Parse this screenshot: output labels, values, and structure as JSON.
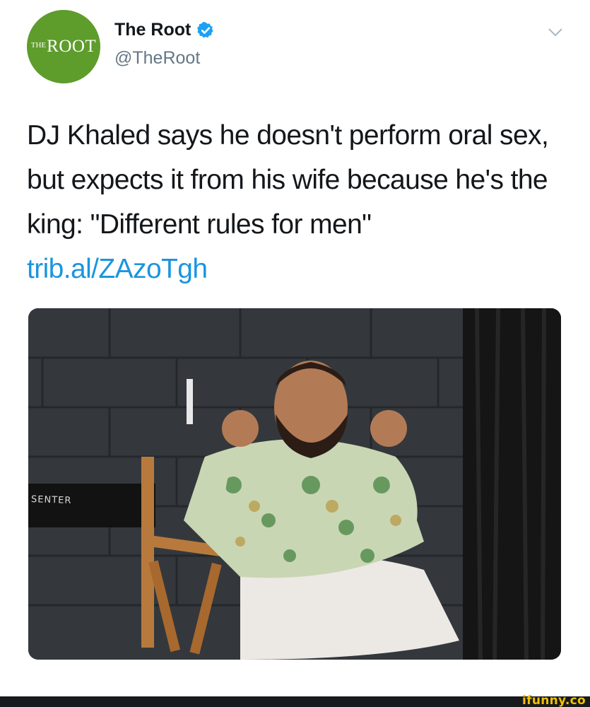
{
  "account": {
    "avatar_text_small": "THE",
    "avatar_text_large": "ROOT",
    "display_name": "The Root",
    "handle": "@TheRoot",
    "verified_icon": "verified-badge-icon",
    "menu_icon": "chevron-down-icon"
  },
  "tweet": {
    "text": "DJ Khaled says he doesn't perform oral sex, but expects it from his wife because he's the king: \"Different rules for men\"",
    "link": "trib.al/ZAzoTgh"
  },
  "photo": {
    "chair_text": "SENTER"
  },
  "watermark": {
    "text": "ifunny.co"
  },
  "colors": {
    "avatar_bg": "#5e9c2c",
    "verified": "#1da1f2",
    "link": "#1b95e0",
    "handle": "#657786",
    "watermark": "#f2c200"
  }
}
